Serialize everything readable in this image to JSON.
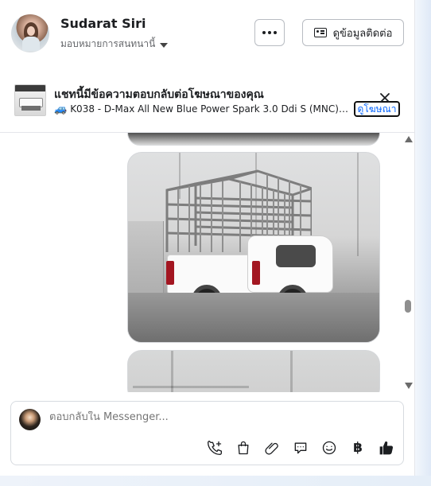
{
  "header": {
    "user_name": "Sudarat Siri",
    "assign_label": "มอบหมายการสนทนานี้",
    "contact_button_label": "ดูข้อมูลติดต่อ"
  },
  "ad_banner": {
    "title": "แชทนี้มีข้อความตอบกลับต่อโฆษณาของคุณ",
    "subtitle": "K038 - D-Max All New Blue Power Spark 3.0 Ddi S (MNC) MT*...",
    "view_ad_label": "ดูโฆษณา"
  },
  "composer": {
    "placeholder": "ตอบกลับใน Messenger..."
  },
  "icons": {
    "more": "more-icon",
    "contact": "contact-card-icon",
    "truck": "truck-icon",
    "close": "close-icon",
    "phone": "phone-add-icon",
    "bag": "shopping-bag-icon",
    "attach": "paperclip-icon",
    "chat": "chat-bubble-icon",
    "emoji": "emoji-icon",
    "currency": "baht-icon",
    "like": "thumbs-up-icon"
  },
  "colors": {
    "accent": "#0866ff",
    "text": "#1c1e21",
    "secondary_text": "#65676b",
    "border": "#d7dbe0"
  }
}
